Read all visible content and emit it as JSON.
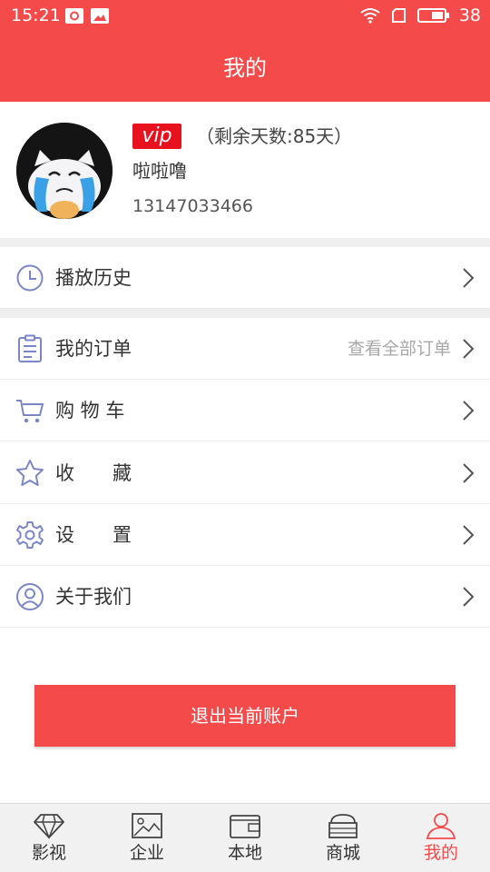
{
  "status_bar": {
    "time": "15:21",
    "battery_level": "38"
  },
  "header": {
    "title": "我的"
  },
  "profile": {
    "vip_label": "vip",
    "remaining_days": "（剩余天数:85天）",
    "nickname": "啦啦噜",
    "phone": "13147033466"
  },
  "menu": {
    "play_history": "播放历史",
    "my_orders": "我的订单",
    "view_all_orders": "查看全部订单",
    "cart": "购 物 车",
    "favorites": "收　　藏",
    "settings": "设　　置",
    "about": "关于我们"
  },
  "logout_label": "退出当前账户",
  "tabs": [
    {
      "label": "影视",
      "icon": "diamond-icon"
    },
    {
      "label": "企业",
      "icon": "image-icon"
    },
    {
      "label": "本地",
      "icon": "wallet-icon"
    },
    {
      "label": "商城",
      "icon": "shop-icon"
    },
    {
      "label": "我的",
      "icon": "user-icon"
    }
  ],
  "colors": {
    "brand": "#f44a4a",
    "vip_badge": "#e8121f",
    "icon_stroke": "#7b86c9"
  }
}
